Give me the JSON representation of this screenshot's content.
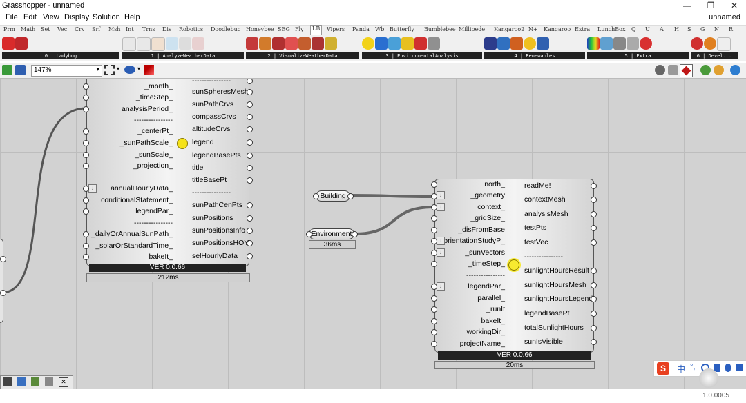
{
  "window": {
    "title": "Grasshopper - unnamed",
    "doc_name": "unnamed"
  },
  "menu": [
    "File",
    "Edit",
    "View",
    "Display",
    "Solution",
    "Help"
  ],
  "tabs": [
    "Prm",
    "Math",
    "Set",
    "Vec",
    "Crv",
    "Srf",
    "Msh",
    "Int",
    "Trns",
    "Dis",
    "Robotics",
    "Doodlebug",
    "Honeybee",
    "SEG",
    "Fly",
    "LB",
    "Vipers",
    "Panda",
    "Wb",
    "Butterfly",
    "Bumblebee",
    "Millipede",
    "Kangaroo2",
    "N+",
    "Kangaroo",
    "Extra",
    "LunchBox",
    "Q",
    "U",
    "A",
    "H",
    "S",
    "G",
    "N",
    "R"
  ],
  "active_tab": "LB",
  "ribbon_groups": [
    "0 | Ladybug",
    "1 | AnalyzeWeatherData",
    "2 | VisualizeWeatherData",
    "3 | EnvironmentalAnalysis",
    "4 | Renewables",
    "5 | Extra",
    "6 | Devel..."
  ],
  "zoom": "147%",
  "comp1": {
    "inputs": [
      "_month_",
      "_timeStep_",
      "analysisPeriod_",
      "----------------",
      "_centerPt_",
      "_sunPathScale_",
      "_sunScale_",
      "_projection_",
      "annualHourlyData_",
      "conditionalStatement_",
      "legendPar_",
      "----------------",
      "_dailyOrAnnualSunPath_",
      "_solarOrStandardTime_",
      "bakeIt_"
    ],
    "outputs": [
      "----------------",
      "sunSpheresMesh",
      "sunPathCrvs",
      "compassCrvs",
      "altitudeCrvs",
      "legend",
      "legendBasePts",
      "title",
      "titleBasePt",
      "----------------",
      "sunPathCenPts",
      "sunPositions",
      "sunPositionsInfo",
      "sunPositionsHOY",
      "selHourlyData"
    ],
    "version": "VER 0.0.66",
    "timer": "212ms"
  },
  "building": {
    "label": "Building"
  },
  "environment": {
    "label": "Environment",
    "timer": "36ms"
  },
  "comp2": {
    "inputs": [
      "north_",
      "_geometry",
      "context_",
      "_gridSize_",
      "_disFromBase",
      "orientationStudyP_",
      "_sunVectors",
      "_timeStep_",
      "----------------",
      "legendPar_",
      "parallel_",
      "_runIt",
      "bakeIt_",
      "workingDir_",
      "projectName_"
    ],
    "outputs": [
      "readMe!",
      "contextMesh",
      "analysisMesh",
      "testPts",
      "testVec",
      "----------------",
      "sunlightHoursResult",
      "sunlightHoursMesh",
      "sunlightHoursLegend",
      "legendBasePt",
      "totalSunlightHours",
      "sunIsVisible"
    ],
    "version": "VER 0.0.66",
    "timer": "20ms"
  },
  "ime": {
    "lang": "中"
  },
  "status": {
    "version": "1.0.0005",
    "left": "..."
  }
}
